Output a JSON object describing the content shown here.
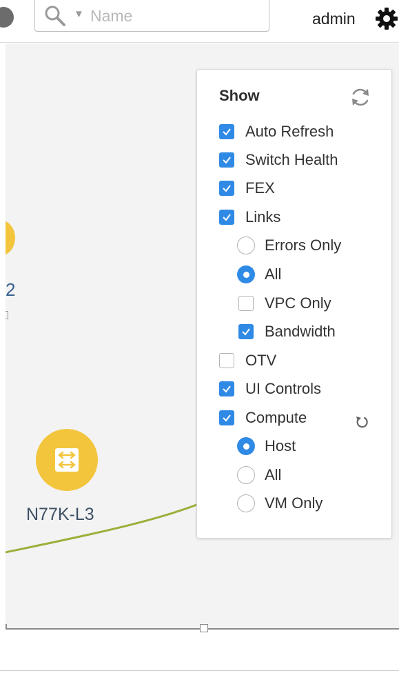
{
  "header": {
    "search_placeholder": "Name",
    "search_value": "",
    "user": "admin"
  },
  "canvas": {
    "partial_node_label": "2",
    "switch_node_label": "N77K-L3"
  },
  "show_panel": {
    "title": "Show",
    "options": {
      "auto_refresh": {
        "label": "Auto Refresh",
        "checked": true
      },
      "switch_health": {
        "label": "Switch Health",
        "checked": true
      },
      "fex": {
        "label": "FEX",
        "checked": true
      },
      "links": {
        "label": "Links",
        "checked": true
      },
      "links_errors_only": {
        "label": "Errors Only",
        "selected": false
      },
      "links_all": {
        "label": "All",
        "selected": true
      },
      "vpc_only": {
        "label": "VPC Only",
        "checked": false
      },
      "bandwidth": {
        "label": "Bandwidth",
        "checked": true
      },
      "otv": {
        "label": "OTV",
        "checked": false
      },
      "ui_controls": {
        "label": "UI Controls",
        "checked": true
      },
      "compute": {
        "label": "Compute",
        "checked": true
      },
      "compute_host": {
        "label": "Host",
        "selected": true
      },
      "compute_all": {
        "label": "All",
        "selected": false
      },
      "compute_vm_only": {
        "label": "VM Only",
        "selected": false
      }
    }
  },
  "colors": {
    "accent": "#2f8ae5",
    "node": "#f2c53d",
    "link": "#9ab03a"
  }
}
